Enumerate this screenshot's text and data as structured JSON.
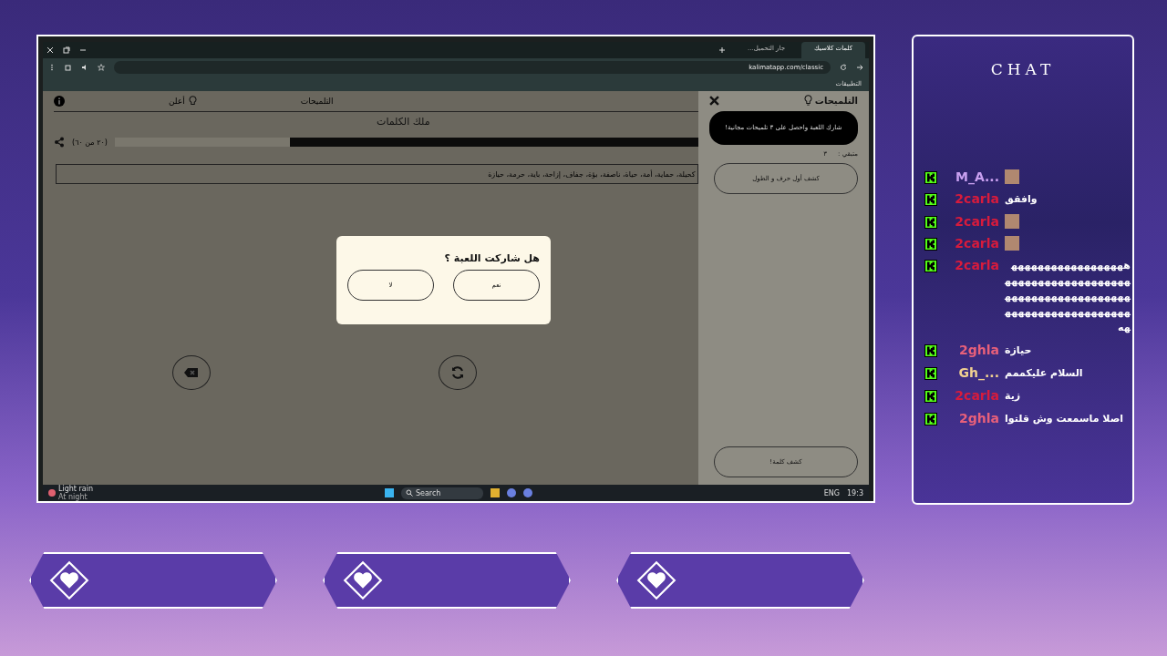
{
  "browser": {
    "tabs": [
      {
        "label": "كلمات كلاسيك",
        "selected": true
      },
      {
        "label": "جار التحميل...",
        "selected": false
      }
    ],
    "url": "kalimatapp.com/classic",
    "bookmark": "التطبيقات"
  },
  "game": {
    "nav": [
      {
        "label": "التلميحات",
        "kind": "hints"
      },
      {
        "label": "أعلن",
        "kind": "plain"
      }
    ],
    "title": "ملك الكلمات",
    "progress": {
      "label": "(٢٠ من ٦٠)",
      "level": 0.7
    },
    "words": "كحيلة، حماية، أمة، حياة، ناصفة، بؤة، جفاف، إزاحة، باية، حرمة، حيازة"
  },
  "hints": {
    "title": "التلميحات",
    "promo": "شارك اللعبة واحصل على ٣ تلميحات مجانية!",
    "remaining_label": "متبقي :",
    "remaining": "٣",
    "buttons": [
      {
        "label": "كشف أول حرف و الطول"
      },
      {
        "label": "كشف كلمة!"
      }
    ]
  },
  "dialog": {
    "question": "هل شاركت اللعبة ؟",
    "buttons": [
      {
        "label": "نعم"
      },
      {
        "label": "لا"
      }
    ]
  },
  "taskbar": {
    "weather": "Light rain",
    "weather_sub": "At night",
    "search": "Search",
    "lang": "ENG",
    "time": "19:3"
  },
  "chat": {
    "title": "CHAT",
    "messages": [
      {
        "user": "M_A...",
        "color": "#c9a0f0",
        "kind": "emote"
      },
      {
        "user": "2carla",
        "color": "#d81b3c",
        "kind": "text",
        "text": "وافقق"
      },
      {
        "user": "2carla",
        "color": "#d81b3c",
        "kind": "emote"
      },
      {
        "user": "2carla",
        "color": "#d81b3c",
        "kind": "emote"
      },
      {
        "user": "2carla",
        "color": "#d81b3c",
        "kind": "text",
        "text": "ههههههههههههههههههههههههههههههههههههههههههههههههههههههههههههههههههههههههههههه"
      },
      {
        "user": "2ghla",
        "color": "#e8607a",
        "kind": "text",
        "text": "حيازة"
      },
      {
        "user": "Gh_...",
        "color": "#f0d090",
        "kind": "text",
        "text": "السلام عليكممم"
      },
      {
        "user": "2carla",
        "color": "#d81b3c",
        "kind": "text",
        "text": "زية"
      },
      {
        "user": "2ghla",
        "color": "#e8607a",
        "kind": "text",
        "text": "اصلا ماسمعت وش قلتوا"
      }
    ]
  }
}
